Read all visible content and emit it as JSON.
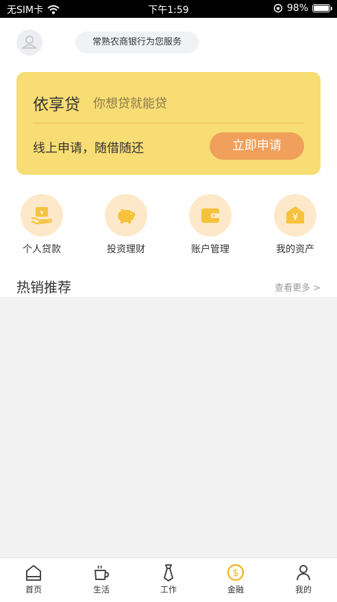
{
  "status_bar": {
    "carrier": "无SIM卡",
    "time": "下午1:59",
    "battery": "98%",
    "battery_level": 0.98
  },
  "header": {
    "avatar_icon": "person-icon",
    "bank_notice": "常熟农商银行为您服务"
  },
  "loan_card": {
    "title": "依享贷",
    "slogan": "你想贷就能贷",
    "description": "线上申请，随借随还",
    "apply_label": "立即申请",
    "colors": {
      "card": "#f8dd74",
      "button": "#f0a05b"
    }
  },
  "menu": {
    "items": [
      {
        "label": "个人贷款",
        "icon": "loan-icon"
      },
      {
        "label": "投资理财",
        "icon": "piggy-bank-icon"
      },
      {
        "label": "账户管理",
        "icon": "wallet-icon"
      },
      {
        "label": "我的资产",
        "icon": "assets-icon"
      }
    ]
  },
  "hot": {
    "title": "热销推荐",
    "more_label": "查看更多 >"
  },
  "tabbar": {
    "items": [
      {
        "label": "首页",
        "icon": "home-icon"
      },
      {
        "label": "生活",
        "icon": "cup-icon"
      },
      {
        "label": "工作",
        "icon": "tie-icon"
      },
      {
        "label": "金融",
        "icon": "coin-icon",
        "active": true
      },
      {
        "label": "我的",
        "icon": "profile-icon"
      }
    ],
    "active_color": "#f2b21b"
  }
}
